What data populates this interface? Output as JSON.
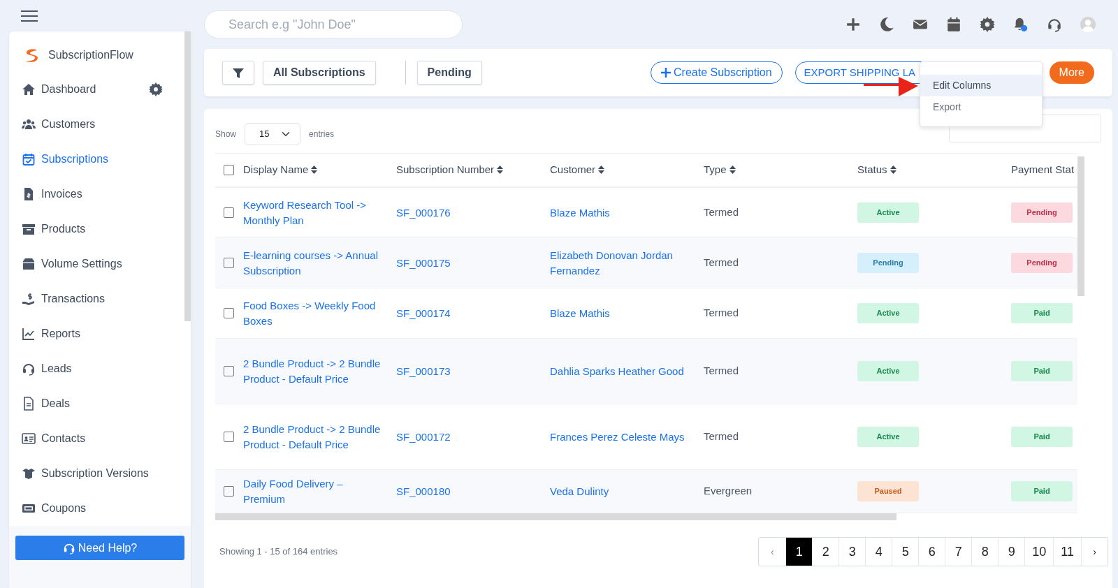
{
  "topbar": {
    "search": {
      "placeholder": "Search e.g \"John Doe\""
    },
    "notification_dot": true
  },
  "sidebar": {
    "brand": "SubscriptionFlow",
    "items": [
      {
        "label": "Dashboard",
        "selected": false,
        "settings": true
      },
      {
        "label": "Customers",
        "selected": false
      },
      {
        "label": "Subscriptions",
        "selected": true
      },
      {
        "label": "Invoices",
        "selected": false
      },
      {
        "label": "Products",
        "selected": false
      },
      {
        "label": "Volume Settings",
        "selected": false
      },
      {
        "label": "Transactions",
        "selected": false
      },
      {
        "label": "Reports",
        "selected": false
      },
      {
        "label": "Leads",
        "selected": false
      },
      {
        "label": "Deals",
        "selected": false
      },
      {
        "label": "Contacts",
        "selected": false
      },
      {
        "label": "Subscription Versions",
        "selected": false
      },
      {
        "label": "Coupons",
        "selected": false
      }
    ],
    "help_button": "Need Help?"
  },
  "toolbar": {
    "views": [
      "All Subscriptions",
      "Pending"
    ],
    "create_button": "Create Subscription",
    "export_button": "EXPORT SHIPPING LA",
    "more_button": "More",
    "menu": [
      {
        "label": "Edit Columns",
        "highlighted": true
      },
      {
        "label": "Export",
        "highlighted": false
      }
    ]
  },
  "table": {
    "all_checked": false,
    "show_label": "Show",
    "page_size": "15",
    "entries_label": "entries",
    "columns": [
      {
        "label": "Display Name",
        "sortable": true
      },
      {
        "label": "Subscription Number",
        "sortable": true
      },
      {
        "label": "Customer",
        "sortable": true
      },
      {
        "label": "Type",
        "sortable": true
      },
      {
        "label": "Status",
        "sortable": true
      },
      {
        "label": "Payment Stat",
        "sortable": false
      }
    ],
    "rows": [
      {
        "checked": false,
        "name": "Keyword Research Tool -> Monthly Plan",
        "number": "SF_000176",
        "customer": "Blaze Mathis",
        "type": "Termed",
        "status": {
          "label": "Active",
          "kind": "success"
        },
        "payment": {
          "label": "Pending",
          "kind": "danger"
        }
      },
      {
        "checked": false,
        "name": "E-learning courses -> Annual Subscription",
        "number": "SF_000175",
        "customer": "Elizabeth Donovan Jordan Fernandez",
        "type": "Termed",
        "status": {
          "label": "Pending",
          "kind": "info"
        },
        "payment": {
          "label": "Pending",
          "kind": "danger"
        }
      },
      {
        "checked": false,
        "name": "Food Boxes -> Weekly Food Boxes",
        "number": "SF_000174",
        "customer": "Blaze Mathis",
        "type": "Termed",
        "status": {
          "label": "Active",
          "kind": "success"
        },
        "payment": {
          "label": "Paid",
          "kind": "success"
        }
      },
      {
        "checked": false,
        "name": "2 Bundle Product -> 2 Bundle Product - Default Price",
        "number": "SF_000173",
        "customer": "Dahlia Sparks Heather Good",
        "type": "Termed",
        "status": {
          "label": "Active",
          "kind": "success"
        },
        "payment": {
          "label": "Paid",
          "kind": "success"
        }
      },
      {
        "checked": false,
        "name": "2 Bundle Product -> 2 Bundle Product - Default Price",
        "number": "SF_000172",
        "customer": "Frances Perez Celeste Mays",
        "type": "Termed",
        "status": {
          "label": "Active",
          "kind": "success"
        },
        "payment": {
          "label": "Paid",
          "kind": "success"
        }
      },
      {
        "checked": false,
        "name": "Daily Food Delivery – Premium",
        "number": "SF_000180",
        "customer": "Veda Dulinty",
        "type": "Evergreen",
        "status": {
          "label": "Paused",
          "kind": "warning"
        },
        "payment": {
          "label": "Paid",
          "kind": "success"
        }
      }
    ],
    "summary": "Showing 1 - 15 of 164 entries",
    "pagination": {
      "prev": "‹",
      "next": "›",
      "pages": [
        {
          "label": "1",
          "selected": true
        },
        {
          "label": "2",
          "selected": false
        },
        {
          "label": "3",
          "selected": false
        },
        {
          "label": "4",
          "selected": false
        },
        {
          "label": "5",
          "selected": false
        },
        {
          "label": "6",
          "selected": false
        },
        {
          "label": "7",
          "selected": false
        },
        {
          "label": "8",
          "selected": false
        },
        {
          "label": "9",
          "selected": false
        },
        {
          "label": "10",
          "selected": false
        },
        {
          "label": "11",
          "selected": false
        }
      ]
    }
  }
}
